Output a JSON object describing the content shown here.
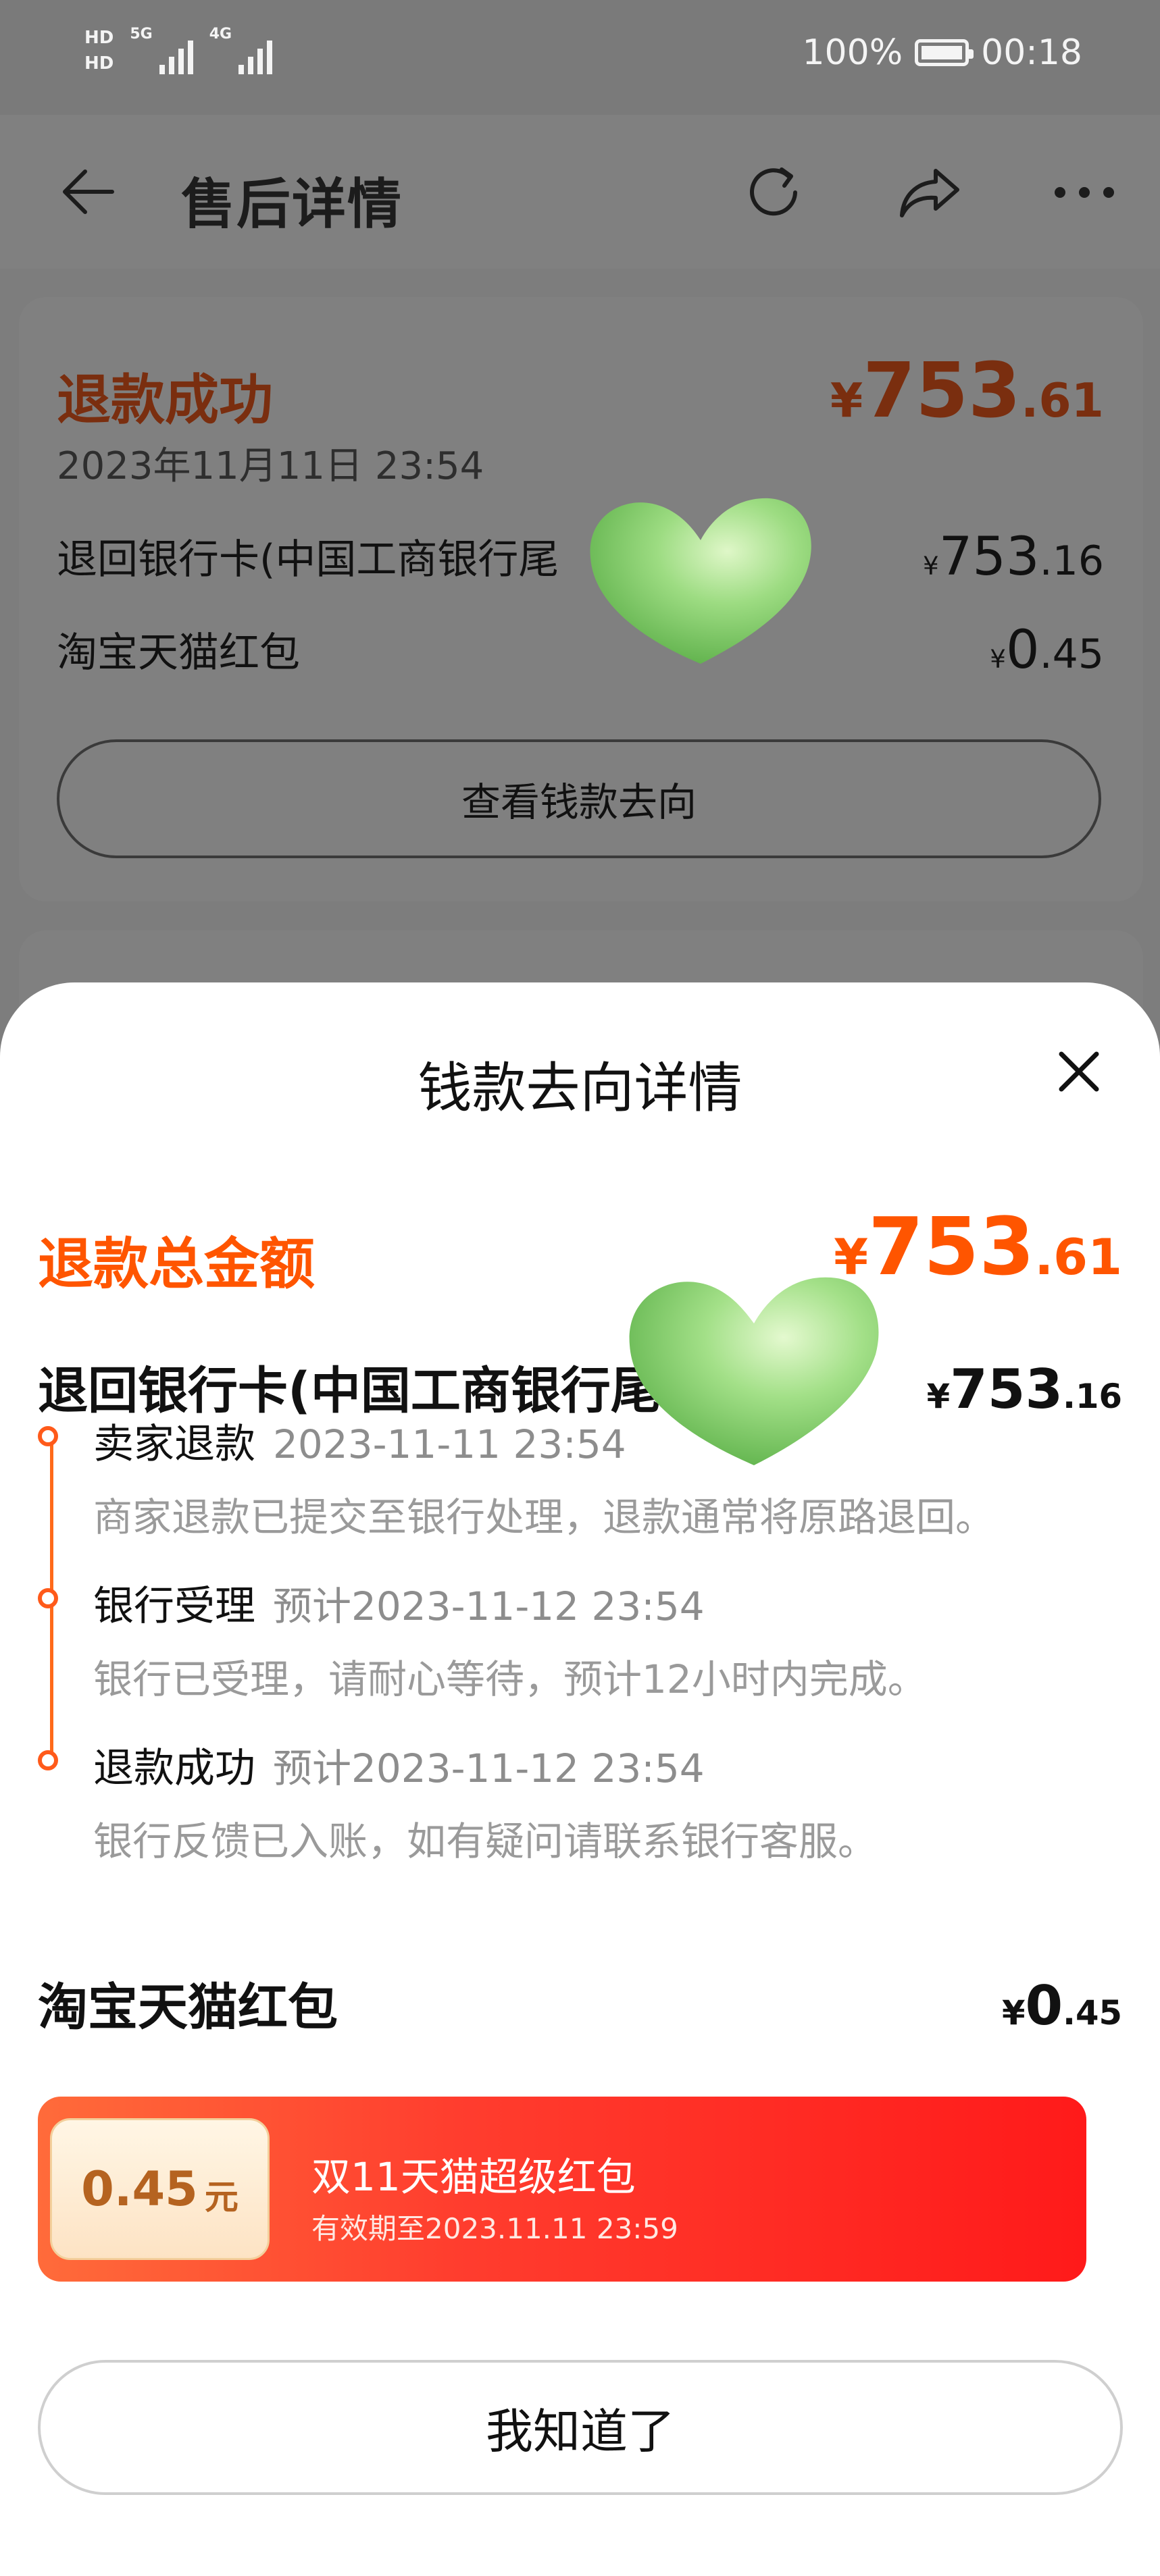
{
  "status_bar": {
    "hd1": "HD",
    "hd2": "HD",
    "net1": "5G",
    "net2": "4G",
    "battery": "100%",
    "time": "00:18"
  },
  "nav": {
    "title": "售后详情",
    "icons": [
      "back-arrow-icon",
      "refresh-icon",
      "share-icon",
      "more-icon"
    ]
  },
  "card": {
    "status": "退款成功",
    "amount": {
      "yen": "¥",
      "int": "753",
      "dec": ".61"
    },
    "date": "2023年11月11日 23:54",
    "rows": [
      {
        "label": "退回银行卡(中国工商银行尾",
        "yen": "¥",
        "int": "753",
        "dec": ".16"
      },
      {
        "label": "淘宝天猫红包",
        "yen": "¥",
        "int": "0",
        "dec": ".45"
      }
    ],
    "button": "查看钱款去向"
  },
  "sheet": {
    "title": "钱款去向详情",
    "total_label": "退款总金额",
    "total": {
      "yen": "¥",
      "int": "753",
      "dec": ".61"
    },
    "bank": {
      "label": "退回银行卡(中国工商银行尾",
      "yen": "¥",
      "int": "753",
      "dec": ".16"
    },
    "timeline": [
      {
        "name": "卖家退款",
        "time": "2023-11-11 23:54",
        "desc": "商家退款已提交至银行处理，退款通常将原路退回。"
      },
      {
        "name": "银行受理",
        "time": "预计2023-11-12 23:54",
        "desc": "银行已受理，请耐心等待，预计12小时内完成。"
      },
      {
        "name": "退款成功",
        "time": "预计2023-11-12 23:54",
        "desc": "银行反馈已入账，如有疑问请联系银行客服。"
      }
    ],
    "redpacket": {
      "label": "淘宝天猫红包",
      "yen": "¥",
      "int": "0",
      "dec": ".45"
    },
    "coupon": {
      "value": "0.45",
      "unit": "元",
      "name": "双11天猫超级红包",
      "expiry": "有效期至2023.11.11 23:59"
    },
    "confirm": "我知道了"
  },
  "colors": {
    "accent": "#ff5500",
    "timeline": "#ff5a1a",
    "coupon_red": "#ff1a1a"
  }
}
